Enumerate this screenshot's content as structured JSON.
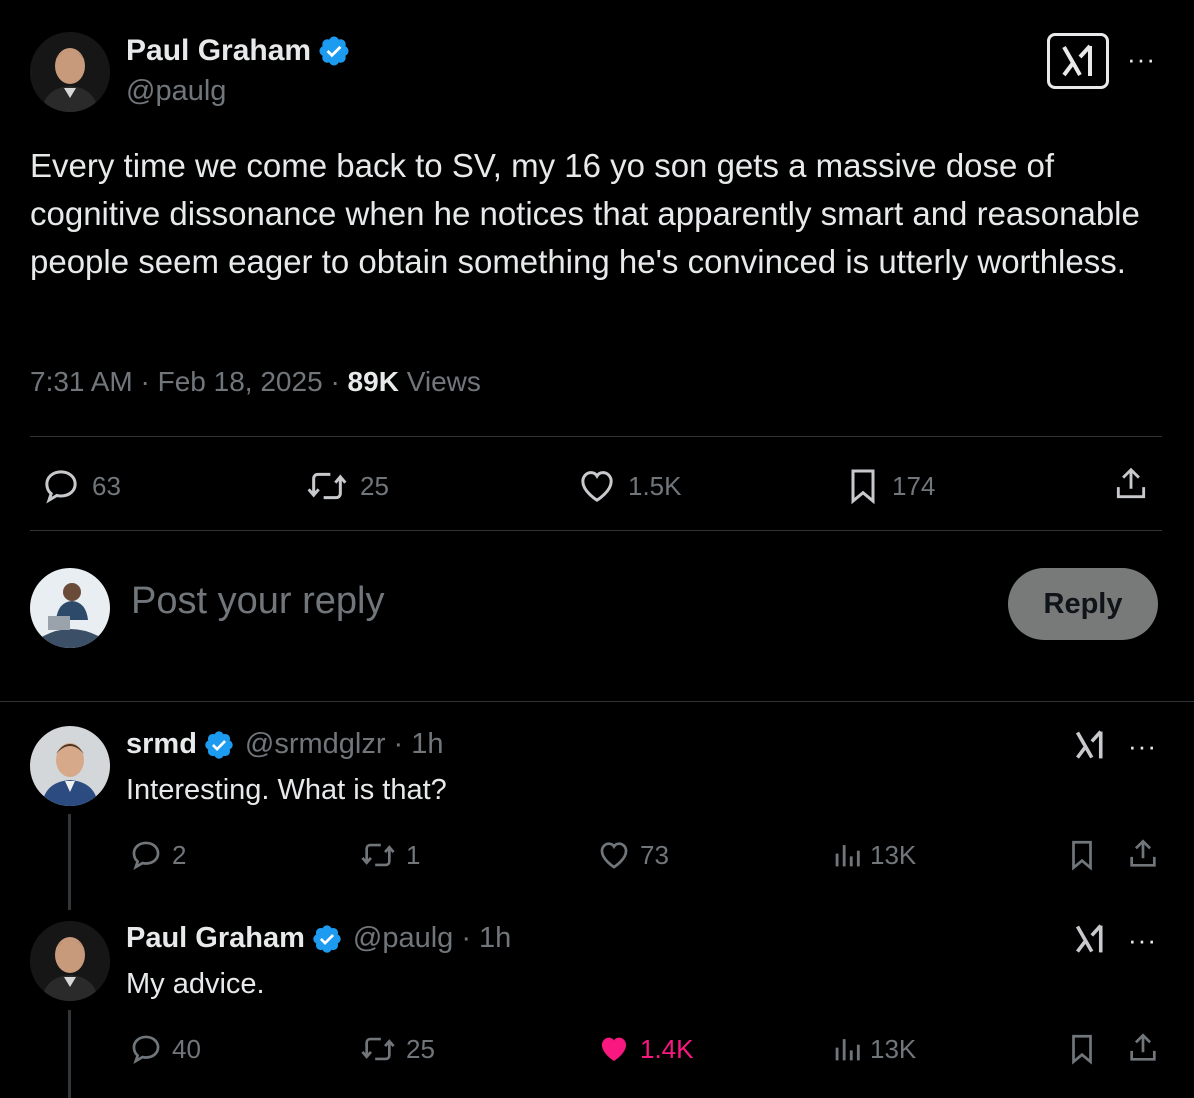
{
  "main_tweet": {
    "author_name": "Paul Graham",
    "author_handle": "@paulg",
    "text": "Every time we come back to SV, my 16 yo son gets a massive dose of cognitive dissonance when he notices that apparently smart and reasonable people seem eager to obtain something he's convinced is utterly worthless.",
    "time": "7:31 AM",
    "separator": "·",
    "date": "Feb 18, 2025",
    "views_count": "89K",
    "views_label": "Views",
    "stats": {
      "replies": "63",
      "reposts": "25",
      "likes": "1.5K",
      "bookmarks": "174"
    },
    "more_label": "···"
  },
  "composer": {
    "placeholder": "Post your reply",
    "reply_button": "Reply"
  },
  "replies": [
    {
      "author_name": "srmd",
      "author_handle": "@srmdglzr",
      "time": "· 1h",
      "text": "Interesting. What is that?",
      "stats": {
        "replies": "2",
        "reposts": "1",
        "likes": "73",
        "views": "13K"
      },
      "liked": false,
      "more_label": "···"
    },
    {
      "author_name": "Paul Graham",
      "author_handle": "@paulg",
      "time": "· 1h",
      "text": "My advice.",
      "stats": {
        "replies": "40",
        "reposts": "25",
        "likes": "1.4K",
        "views": "13K"
      },
      "liked": true,
      "more_label": "···"
    }
  ],
  "colors": {
    "background": "#000000",
    "text": "#e7e9ea",
    "secondary": "#71767b",
    "verified": "#1d9bf0",
    "like": "#f91880",
    "divider": "#2f3336"
  },
  "icons": [
    "verified-badge-icon",
    "grok-icon",
    "more-icon",
    "reply-icon",
    "repost-icon",
    "like-icon",
    "bookmark-icon",
    "share-icon",
    "views-icon"
  ]
}
